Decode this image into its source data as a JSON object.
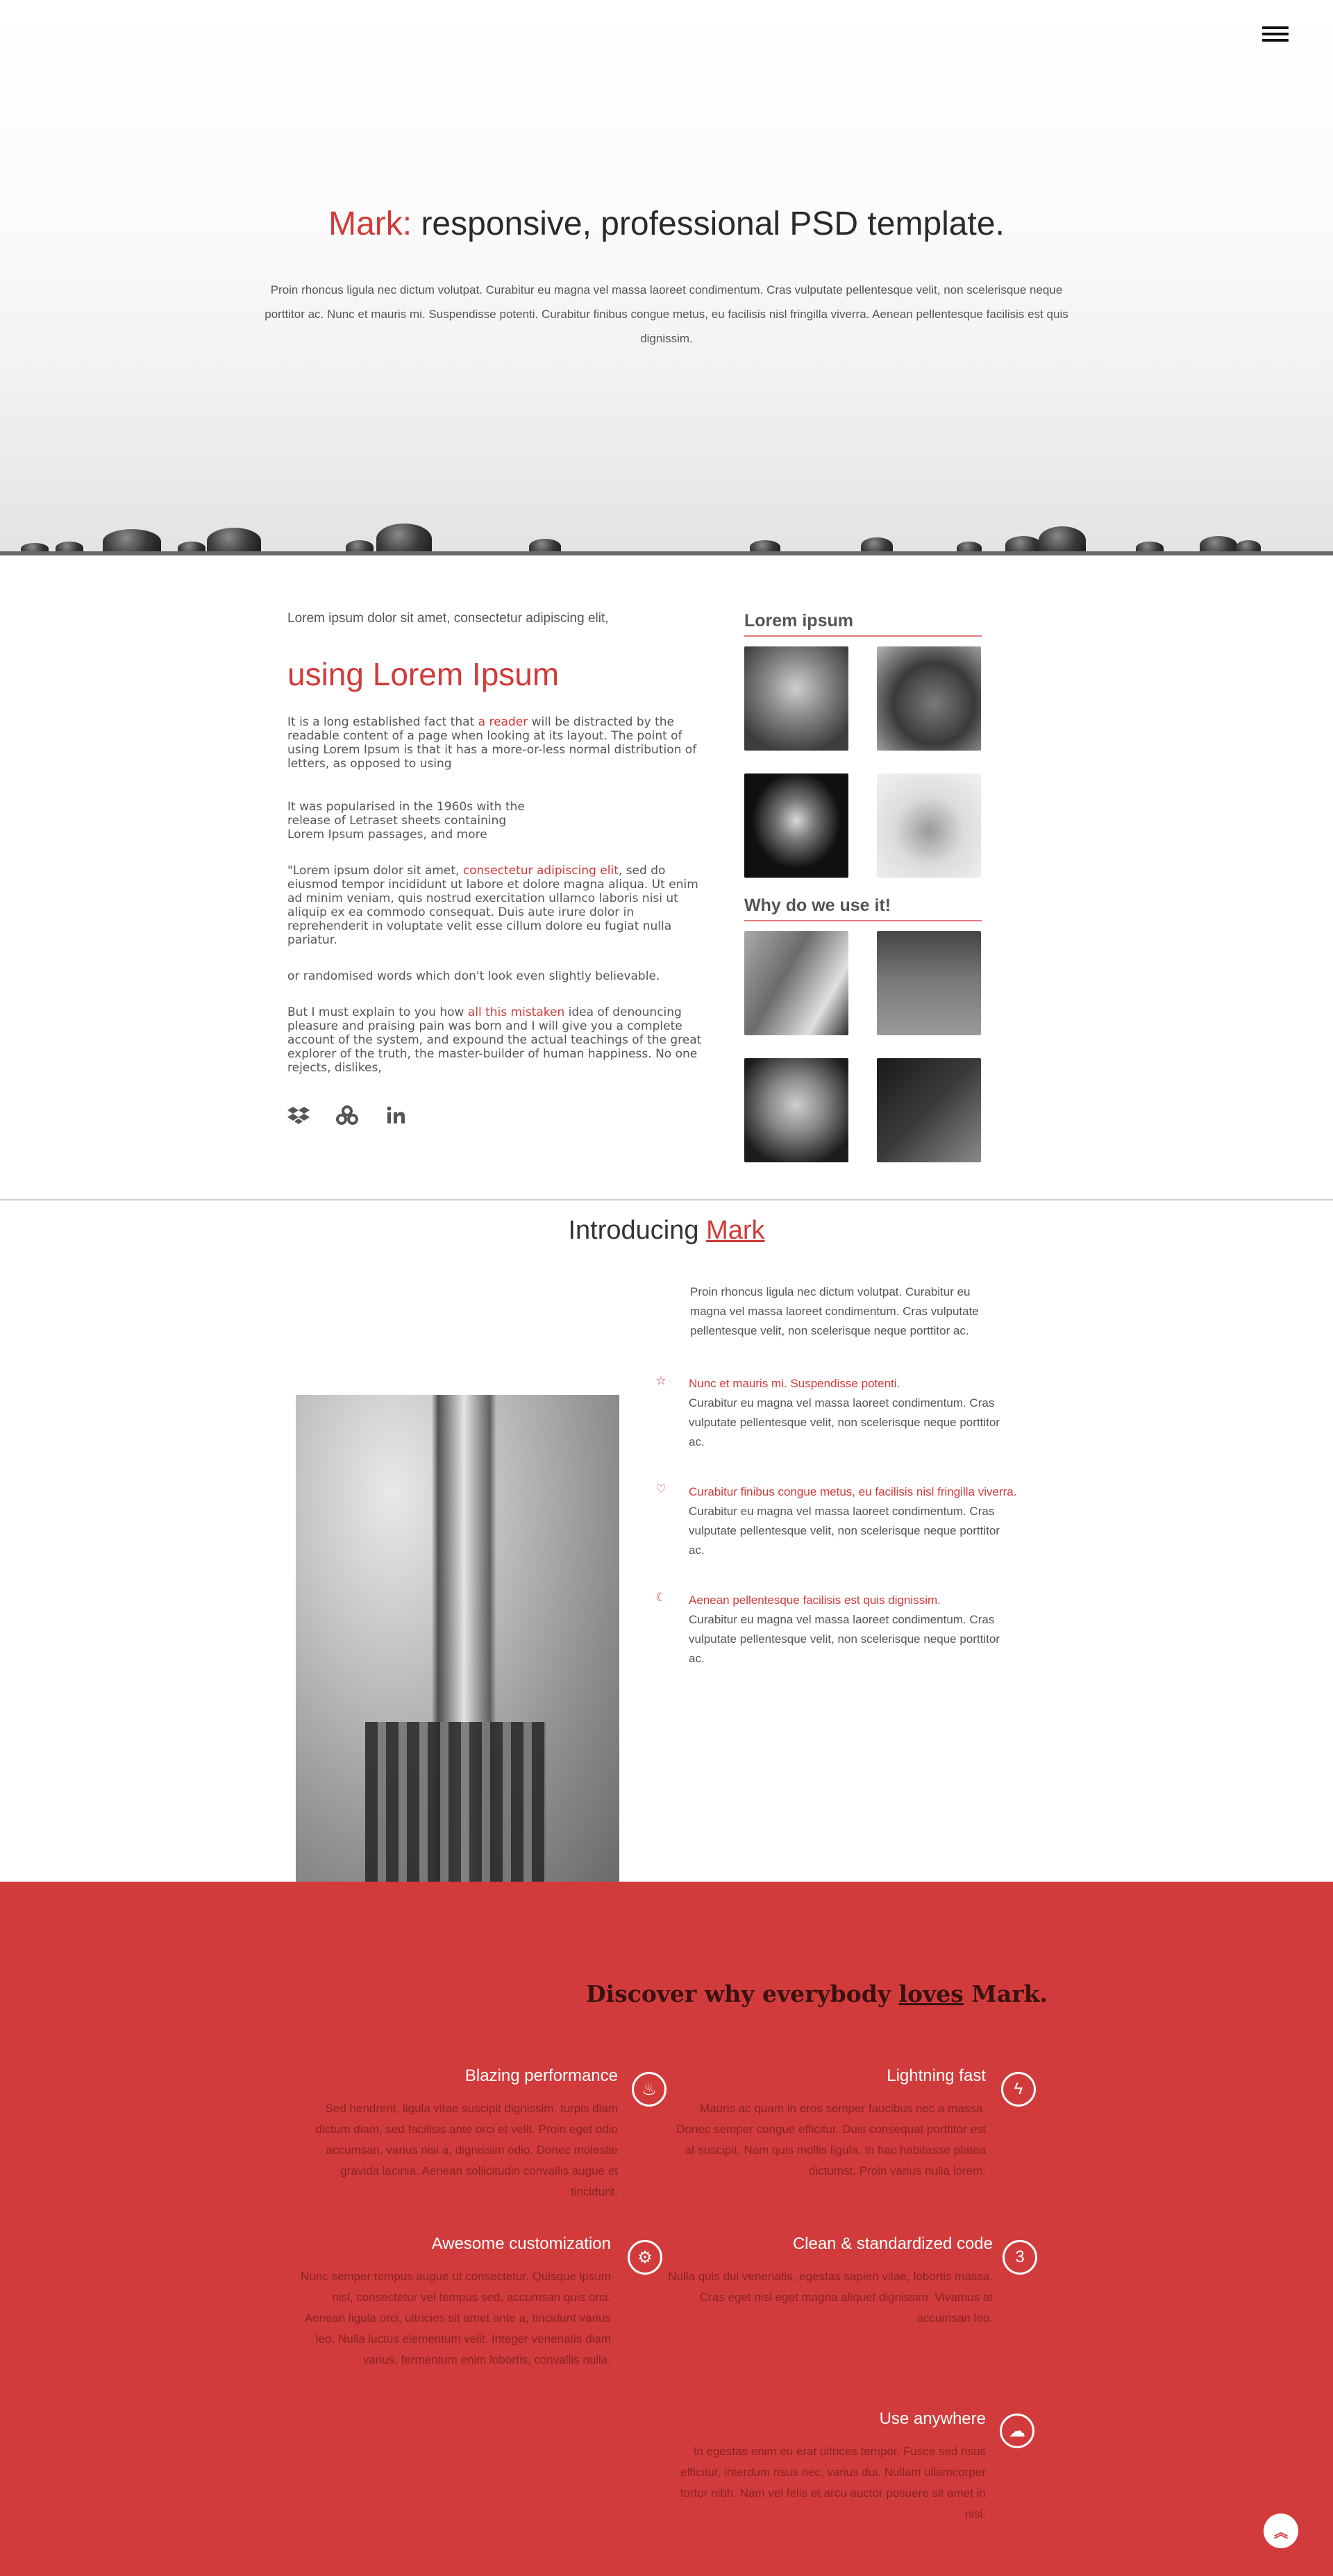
{
  "hero": {
    "title_accent": "Mark:",
    "title_rest": " responsive, professional PSD template.",
    "text": "Proin rhoncus ligula nec dictum volutpat. Curabitur eu magna vel massa laoreet condimentum. Cras vulputate pellentesque velit, non scelerisque neque porttitor ac. Nunc et mauris mi. Suspendisse potenti. Curabitur finibus congue metus, eu facilisis nisl fringilla viverra. Aenean pellentesque facilisis est quis dignissim."
  },
  "content": {
    "intro_line": "Lorem ipsum dolor sit amet, consectetur adipiscing elit,",
    "heading": "using Lorem Ipsum",
    "p1_a": "It is a long established fact that ",
    "p1_link": "a reader",
    "p1_b": " will be distracted by the readable content of a page when looking at its layout. The point of using Lorem Ipsum is that it has a more-or-less normal distribution of letters, as opposed to using",
    "p2": "It was popularised in the 1960s with the release of Letraset sheets containing Lorem Ipsum passages, and more",
    "p3_a": "\"Lorem ipsum dolor sit amet, ",
    "p3_link": "consectetur adipiscing elit",
    "p3_b": ", sed do eiusmod tempor incididunt ut labore et dolore magna aliqua. Ut enim ad minim veniam, quis nostrud exercitation ullamco laboris nisi ut aliquip ex ea commodo consequat. Duis aute irure dolor in reprehenderit in voluptate velit esse cillum dolore eu fugiat nulla pariatur.",
    "p4": "or randomised words which don't look even slightly believable.",
    "p5_a": "But I must explain to you how ",
    "p5_link": "all this mistaken",
    "p5_b": " idea of denouncing pleasure and praising pain was born and I will give you a complete account of the system, and expound the actual teachings of the great explorer of the truth, the master-builder of human happiness. No one rejects, dislikes,",
    "side_title_1": "Lorem ipsum",
    "side_title_2": "Why do we use it!"
  },
  "intro": {
    "title": "Introducing ",
    "title_link": "Mark",
    "lead": "Proin rhoncus ligula nec dictum volutpat. Curabitur eu magna vel massa laoreet condimentum. Cras vulputate pellentesque velit, non scelerisque neque porttitor ac.",
    "features": [
      {
        "icon": "star-icon",
        "head": "Nunc et mauris mi. Suspendisse potenti.",
        "body": "Curabitur eu magna vel massa laoreet condimentum. Cras vulputate pellentesque velit, non scelerisque neque porttitor ac."
      },
      {
        "icon": "heart-icon",
        "head": "Curabitur finibus congue metus, eu facilisis nisl fringilla viverra.",
        "body": "Curabitur eu magna vel massa laoreet condimentum. Cras vulputate pellentesque velit, non scelerisque neque porttitor ac."
      },
      {
        "icon": "moon-icon",
        "head": "Aenean pellentesque facilisis est quis dignissim.",
        "body": "Curabitur eu magna vel massa laoreet condimentum. Cras vulputate pellentesque velit, non scelerisque neque porttitor ac."
      }
    ]
  },
  "red": {
    "title_a": "Discover why everybody ",
    "title_u": "loves",
    "title_b": " Mark.",
    "f1_title": "Blazing performance",
    "f1_body": "Sed hendrerit, ligula vitae suscipit dignissim, turpis diam dictum diam, sed facilisis ante orci et velit. Proin eget odio accumsan, varius nisi a, dignissim odio. Donec molestie gravida lacinia. Aenean sollicitudin convallis augue et tincidunt.",
    "f2_title": "Lightning fast",
    "f2_body": "Mauris ac quam in eros semper faucibus nec a massa. Donec semper congue efficitur. Duis consequat porttitor est at suscipit. Nam quis mollis ligula. In hac habitasse platea dictumst. Proin varius nulla lorem.",
    "f3_title": "Awesome customization",
    "f3_body": "Nunc semper tempus augue ut consectetur. Quisque ipsum nisl, consectetur vel tempus sed, accumsan quis orci. Aenean ligula orci, ultricies sit amet ante a, tincidunt varius leo. Nulla luctus elementum velit. Integer venenatis diam varius, fermentum enim lobortis, convallis nulla.",
    "f4_title": "Clean & standardized code",
    "f4_body": "Nulla quis dui venenatis, egestas sapien vitae, lobortis massa. Cras eget nisl eget magna aliquet dignissim. Vivamus at accumsan leo.",
    "f5_title": "Use anywhere",
    "f5_body": "In egestas enim eu erat ultrices tempor. Fusce sed risus efficitur, interdum risus nec, varius dui. Nullam ullamcorper tortor nibh. Nam vel felis et arcu auctor posuere sit amet in nisi."
  },
  "icons": {
    "menu": "hamburger-menu-icon",
    "social": [
      "dropbox-icon",
      "circles-icon",
      "linkedin-icon"
    ],
    "red": [
      "flame-icon",
      "bolt-icon",
      "gear-icon",
      "css3-icon",
      "cloud-icon"
    ],
    "top": "chevron-double-up-icon"
  },
  "colors": {
    "accent": "#d23a3a",
    "red_bg": "#d23b3b"
  }
}
